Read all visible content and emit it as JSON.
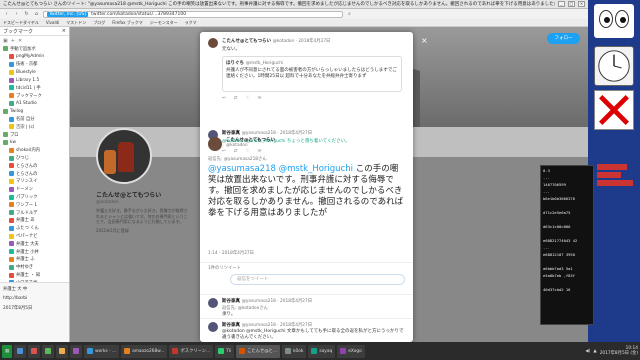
{
  "window": {
    "title": "こたんせ@とてもつらい さんのツイート: \"@yasumasa218 @mstk_Horiguchi この手の嘲笑は放置出来ないです。刑事弁護に対する侮辱です。撤回を求めましたが応じませんのでしかるべき対応を取るしかありません。撤回されるのであれば拳を下げる用意はありましたが\" - Vivaldi"
  },
  "nav": {
    "url_badge": "Twitter, Inc. [US]",
    "url": "twitter.com/kotadon/status/...3789347100"
  },
  "bookmarks": [
    "ドスピードダイヤル",
    "Vivaldi",
    "マストドン",
    "ブログ",
    "Firefox ブックマ",
    "ジーモンスター",
    "ラクマ"
  ],
  "sidebar": {
    "title": "ブックマーク",
    "items": [
      {
        "label": "手動で追加ボ",
        "sub": false
      },
      {
        "label": "pngMyAdmin",
        "sub": true
      },
      {
        "label": "技術 - 京都",
        "sub": true
      },
      {
        "label": "Bluestyle",
        "sub": true
      },
      {
        "label": "Library 1.5",
        "sub": true
      },
      {
        "label": "tdcid11 | 手",
        "sub": true
      },
      {
        "label": "ブックマーク",
        "sub": true
      },
      {
        "label": "A1 Studio",
        "sub": true
      },
      {
        "label": "Twilog",
        "sub": false
      },
      {
        "label": "名前 自分",
        "sub": true
      },
      {
        "label": "吉宗 | (c)",
        "sub": true
      },
      {
        "label": "プロ",
        "sub": false
      },
      {
        "label": "kw",
        "sub": false
      },
      {
        "label": "shokai(内内",
        "sub": true
      },
      {
        "label": "ひつじ",
        "sub": true
      },
      {
        "label": "とらさんの",
        "sub": true
      },
      {
        "label": "とらさんの",
        "sub": true
      },
      {
        "label": "マリンスイ",
        "sub": true
      },
      {
        "label": "ドーメン",
        "sub": true
      },
      {
        "label": "パブリック",
        "sub": true
      },
      {
        "label": "ワンプー 1",
        "sub": true
      },
      {
        "label": "フルドルデ",
        "sub": true
      },
      {
        "label": "弁護士 あ",
        "sub": true
      },
      {
        "label": "ふたつ くん",
        "sub": true
      },
      {
        "label": "ペパーナビ",
        "sub": true
      },
      {
        "label": "弁護士 大夫",
        "sub": true
      },
      {
        "label": "弁護士 小井",
        "sub": true
      },
      {
        "label": "弁護士 ふ",
        "sub": true
      },
      {
        "label": "中村ゆき",
        "sub": true
      },
      {
        "label": "弁護士 ・ 知",
        "sub": true
      },
      {
        "label": "山口美千代",
        "sub": true
      }
    ],
    "footer": [
      "弁護士 大 中",
      "http://barbi",
      "2017年8月5日"
    ]
  },
  "profile": {
    "name": "こたんせ@とてもつらい",
    "handle": "@kotadon",
    "bio": "弁護士大好き。勝手ながら大好き。我慢力が取得されるとシャンとは強いです。何かの専門家ということで、吉田専門家になるように行動しています。",
    "joined": "2011年2月に登録",
    "follow": "フォロー"
  },
  "modal": {
    "q_name": "こたんせ@とてもつらい",
    "q_handle": "@kotadon · 2018年4月27日",
    "q_text": "元ない。",
    "q_box_name": "ほりぐち",
    "q_box_handle": "@mstk_Horiguchi",
    "q_box_text": "弁護人が不同意にされてる面の被害者の方がいらっしゃいましたらはどうしますでご連絡ください。1時間25日以 超料で十分あなたを弁総弁弁士寄りまず",
    "r1_name": "斯谷泰真",
    "r1_handle": "@yasumasa218 · 2018年4月27日",
    "r1_text": "@kotadon @mstk_Horiguchi ちょっと落ち着いてください。",
    "main_name": "こたんせ@とてもつらい",
    "main_handle": "@kotadon",
    "reply_to": "返信先: @yasumasa218さん",
    "main_mentions": "@yasumasa218 @mstk_Horiguchi",
    "main_text": "この手の嘲笑は放置出来ないです。刑事弁護に対する侮辱です。撤回を求めましたが応じませんのでしかるべき対応を取るしかありません。撤回されるのであれば拳を下げる用意はありましたが",
    "main_time": "1:14 - 2018年4月27日",
    "main_stats": "1件のリツイート",
    "reply_placeholder": "返信をツイート",
    "b1_name": "斯谷泰真",
    "b1_handle": "@yasumasa218 · 2018年4月27日",
    "b1_reply": "返信先: @kotadonさん",
    "b1_text": "承り。",
    "b2_name": "斯谷泰真",
    "b2_handle": "@yasumasa218 · 2018年4月27日",
    "b2_text": "@kotadon @mstk_Horiguchi 文章かもしてても手に取る全の返を私がと方にうっかりで違う書き込んでください。"
  },
  "terminal": [
    "  0.3",
    "  ...",
    "1467706599",
    "  ...",
    "b6e1b0b3066376",
    "",
    "d71c2e5e0a75",
    "",
    "d63c1c00c000",
    "",
    "e68821774043 42",
    "  ...",
    "e68812107 3950",
    "",
    "a6bbb7ad3 5a1",
    "e5a0b7eb ,f83f",
    "",
    "40d37cbd2 16"
  ],
  "taskbar": [
    {
      "label": "",
      "color": "#4a90d9"
    },
    {
      "label": "",
      "color": "#d9534f"
    },
    {
      "label": "",
      "color": "#5cb85c"
    },
    {
      "label": "",
      "color": "#f0ad4e"
    },
    {
      "label": "",
      "color": "#9b59b6"
    },
    {
      "label": "works - ...",
      "color": "#3498db"
    },
    {
      "label": "amaozo268w...",
      "color": "#e67e22"
    },
    {
      "label": "ポスクリーン...",
      "color": "#c0392b"
    },
    {
      "label": "Tli",
      "color": "#2ecc71"
    },
    {
      "label": "こたんせ@と...",
      "color": "#d35400"
    },
    {
      "label": "k0ok",
      "color": "#7f8c8d"
    },
    {
      "label": "sayaq",
      "color": "#16a085"
    },
    {
      "label": "eXogo",
      "color": "#8e44ad"
    }
  ],
  "clock": {
    "time": "10:14",
    "date": "2017年8月5日 (金)"
  }
}
